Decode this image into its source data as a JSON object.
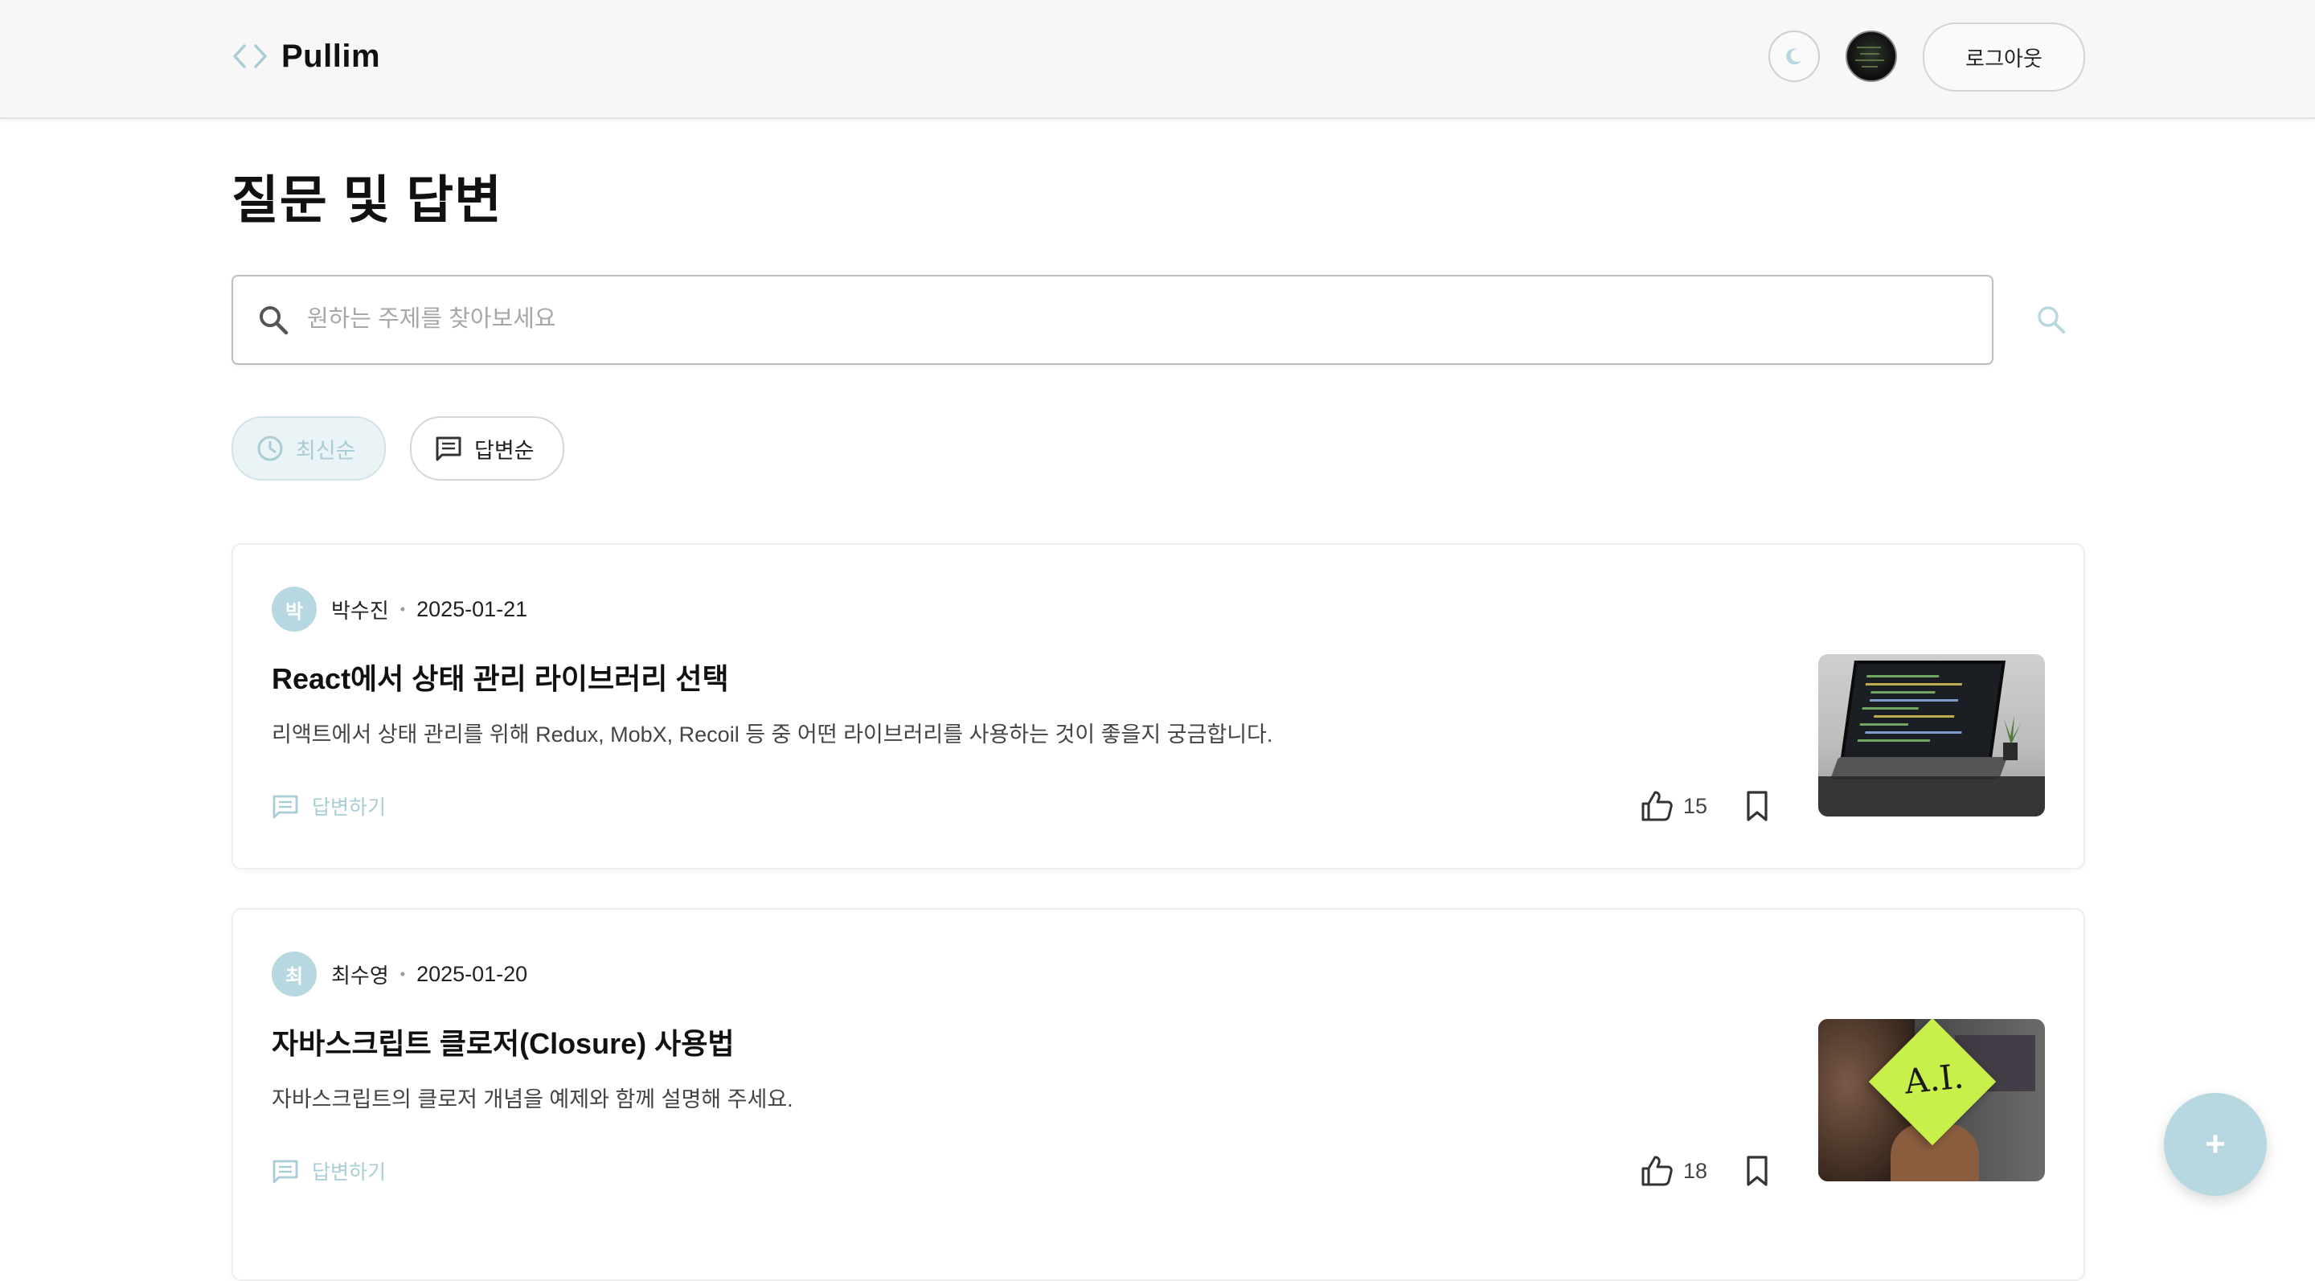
{
  "header": {
    "brand": "Pullim",
    "logout_label": "로그아웃",
    "theme_icon": "moon-icon",
    "logo_icon": "code-brackets-icon"
  },
  "page": {
    "title": "질문 및 답변"
  },
  "search": {
    "placeholder": "원하는 주제를 찾아보세요",
    "value": ""
  },
  "sort": {
    "options": [
      {
        "label": "최신순",
        "icon": "clock-icon",
        "active": true
      },
      {
        "label": "답변순",
        "icon": "comment-icon",
        "active": false
      }
    ]
  },
  "questions": [
    {
      "initial": "박",
      "author": "박수진",
      "date": "2025-01-21",
      "title": "React에서 상태 관리 라이브러리 선택",
      "description": "리액트에서 상태 관리를 위해 Redux, MobX, Recoil 등 중 어떤 라이브러리를 사용하는 것이 좋을지 궁금합니다.",
      "answer_label": "답변하기",
      "likes": "15"
    },
    {
      "initial": "최",
      "author": "최수영",
      "date": "2025-01-20",
      "title": "자바스크립트 클로저(Closure) 사용법",
      "description": "자바스크립트의 클로저 개념을 예제와 함께 설명해 주세요.",
      "answer_label": "답변하기",
      "likes": "18",
      "thumbnail_text": "A.I."
    }
  ],
  "fab": {
    "label": "+"
  },
  "colors": {
    "accent": "#b7d8e0",
    "accent_text": "#a9cdd6",
    "header_bg": "#f7f7f7"
  }
}
